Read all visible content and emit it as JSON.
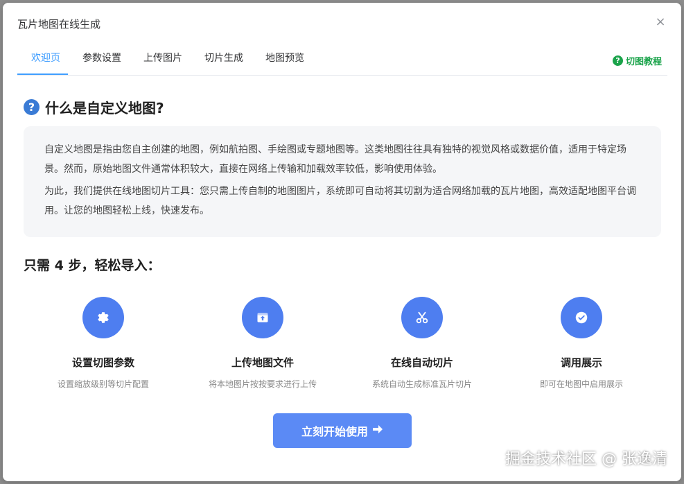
{
  "dialog": {
    "title": "瓦片地图在线生成",
    "close_label": "×"
  },
  "tabs": [
    {
      "label": "欢迎页",
      "active": true
    },
    {
      "label": "参数设置",
      "active": false
    },
    {
      "label": "上传图片",
      "active": false
    },
    {
      "label": "切片生成",
      "active": false
    },
    {
      "label": "地图预览",
      "active": false
    }
  ],
  "tutorial": {
    "label": "切图教程",
    "icon": "question-circle-icon",
    "color": "#1aa34a"
  },
  "intro": {
    "icon": "question-circle-icon",
    "heading": "什么是自定义地图?",
    "paragraphs": [
      "自定义地图是指由您自主创建的地图，例如航拍图、手绘图或专题地图等。这类地图往往具有独特的视觉风格或数据价值，适用于特定场景。然而，原始地图文件通常体积较大，直接在网络上传输和加载效率较低，影响使用体验。",
      "为此，我们提供在线地图切片工具：您只需上传自制的地图图片，系统即可自动将其切割为适合网络加载的瓦片地图，高效适配地图平台调用。让您的地图轻松上线，快速发布。"
    ]
  },
  "steps": {
    "title": "只需 4 步，轻松导入：",
    "items": [
      {
        "icon": "gear-icon",
        "title": "设置切图参数",
        "desc": "设置缩放级别等切片配置"
      },
      {
        "icon": "upload-icon",
        "title": "上传地图文件",
        "desc": "将本地图片按按要求进行上传"
      },
      {
        "icon": "scissors-icon",
        "title": "在线自动切片",
        "desc": "系统自动生成标准瓦片切片"
      },
      {
        "icon": "check-circle-icon",
        "title": "调用展示",
        "desc": "即可在地图中启用展示"
      }
    ]
  },
  "start_button": {
    "label": "立刻开始使用",
    "icon": "arrow-right-icon"
  },
  "watermark": "掘金技术社区 @ 张逸清",
  "colors": {
    "accent": "#409eff",
    "step_icon": "#4e7ef0",
    "button": "#5b8af5"
  }
}
